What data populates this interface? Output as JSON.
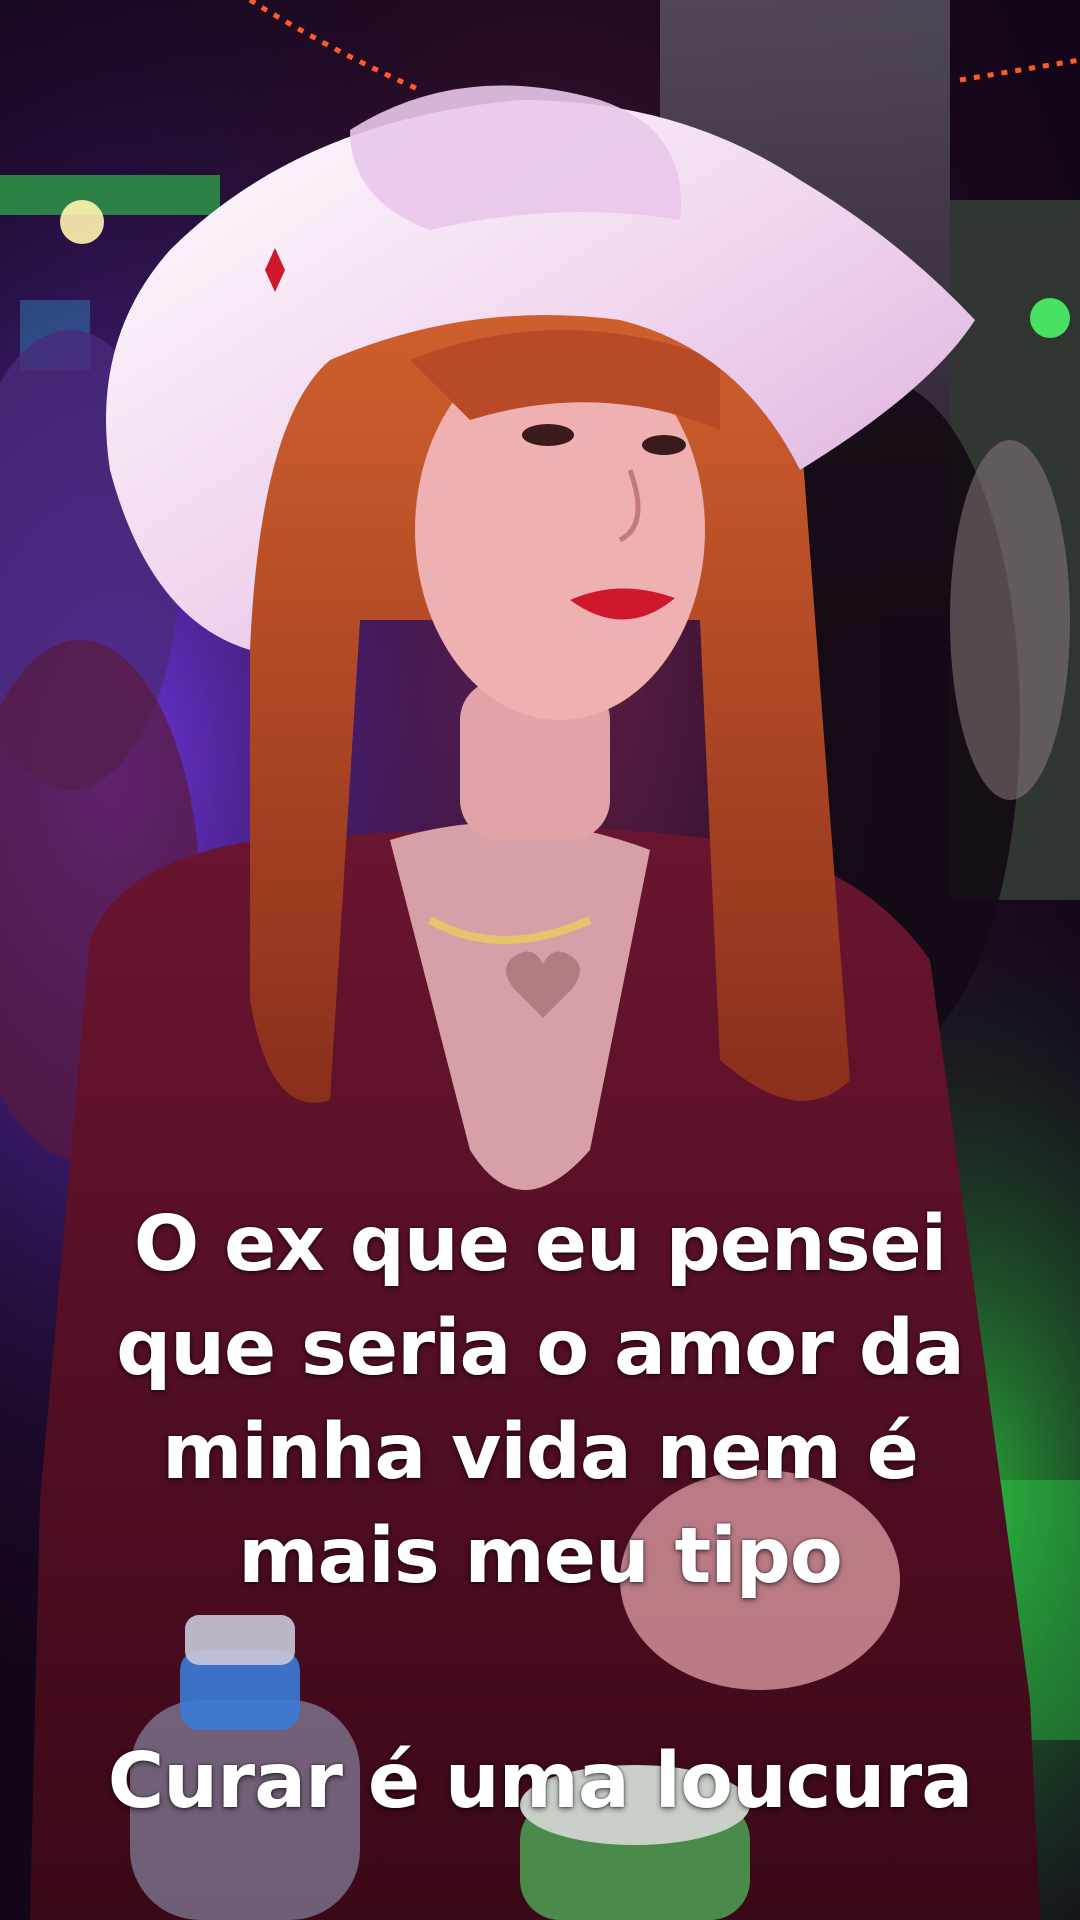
{
  "caption": {
    "line1": "O ex que eu pensei",
    "line2": "que seria o amor da",
    "line3": "minha vida nem é",
    "line4": "mais meu tipo",
    "punchline": "Curar é uma loucura"
  },
  "palette": {
    "background_dark": "#14061a",
    "purple_light": "#7a3cff",
    "green_light": "#2ecc40",
    "red_light": "#ff2a3a",
    "hat_white": "#f4e4f2",
    "hair_auburn": "#c8562e",
    "top_burgundy": "#5a0f22",
    "caption_text": "#ffffff"
  }
}
